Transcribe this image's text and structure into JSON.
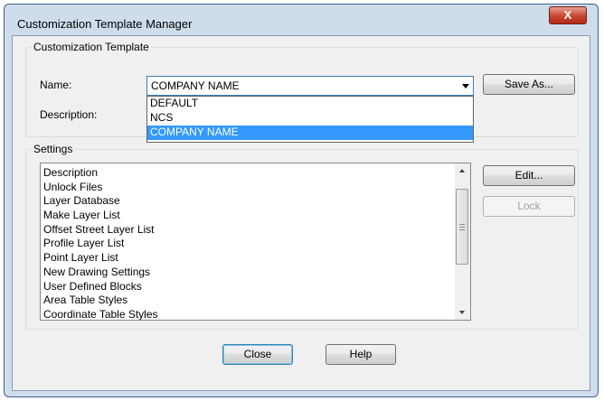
{
  "window": {
    "title": "Customization Template Manager",
    "close_glyph": "X"
  },
  "template_group": {
    "label": "Customization Template",
    "name_label": "Name:",
    "description_label": "Description:",
    "name_value": "COMPANY NAME",
    "options": [
      "DEFAULT",
      "NCS",
      "COMPANY NAME"
    ],
    "selected_index": 2,
    "save_as_label": "Save As..."
  },
  "settings_group": {
    "label": "Settings",
    "items": [
      "Description",
      "Unlock Files",
      "Layer Database",
      "Make Layer List",
      "Offset Street Layer List",
      "Profile Layer List",
      "Point Layer List",
      "New Drawing Settings",
      "User Defined Blocks",
      "Area Table Styles",
      "Coordinate Table Styles"
    ],
    "edit_label": "Edit...",
    "lock_label": "Lock"
  },
  "footer": {
    "close_label": "Close",
    "help_label": "Help"
  },
  "colors": {
    "selection": "#3399ff",
    "close_button": "#c8452f",
    "focus_border": "#3c7fb1"
  },
  "icons": {
    "dropdown": "chevron-down-icon",
    "scroll_up": "arrow-up-icon",
    "scroll_down": "arrow-down-icon"
  }
}
